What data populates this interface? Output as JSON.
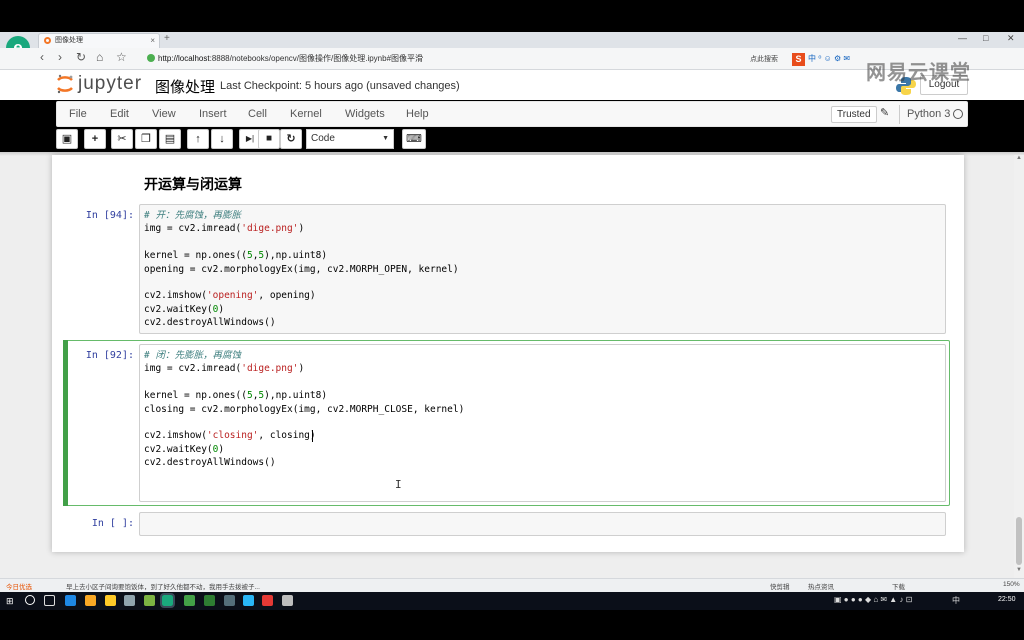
{
  "browser": {
    "tab_title": "图像处理",
    "tab_close": "×",
    "new_tab": "+",
    "url_host": "http://localhost",
    "url_rest": ":8888/notebooks/opencv/图像操作/图像处理.ipynb#图像平滑",
    "search_label": "点此搜索",
    "logo_letter": "e",
    "ext_s": "S",
    "ext_rest": "中 ⁰ ☺ ⚙ ✉",
    "nav_back": "‹",
    "nav_forward": "›",
    "nav_reload": "↻",
    "nav_home": "⌂",
    "nav_star": "☆",
    "min": "—",
    "max": "□",
    "close": "✕"
  },
  "jupyter": {
    "logo_text": "jupyter",
    "notebook_title": "图像处理",
    "checkpoint": "Last Checkpoint: 5 hours ago (unsaved changes)",
    "logout": "Logout",
    "watermark": "网易云课堂",
    "menu": [
      "File",
      "Edit",
      "View",
      "Insert",
      "Cell",
      "Kernel",
      "Widgets",
      "Help"
    ],
    "trusted": "Trusted",
    "kernel": "Python 3",
    "cell_type": "Code",
    "toolbar_glyphs": {
      "save": "▣",
      "add": "+",
      "cut": "✂",
      "copy": "❐",
      "paste": "▤",
      "up": "↑",
      "down": "↓",
      "run": "▶|",
      "stop": "■",
      "restart": "↻",
      "keyboard": "⌨",
      "dropdown": "▼",
      "pencil": "✎"
    }
  },
  "notebook": {
    "heading": "开运算与闭运算",
    "cells": [
      {
        "prompt": "In [94]:",
        "lines": [
          "# 开：先腐蚀，再膨胀",
          "img = cv2.imread('dige.png')",
          "",
          "kernel = np.ones((5,5),np.uint8)",
          "opening = cv2.morphologyEx(img, cv2.MORPH_OPEN, kernel)",
          "",
          "cv2.imshow('opening', opening)",
          "cv2.waitKey(0)",
          "cv2.destroyAllWindows()"
        ]
      },
      {
        "prompt": "In [92]:",
        "lines": [
          "# 闭：先膨胀，再腐蚀",
          "img = cv2.imread('dige.png')",
          "",
          "kernel = np.ones((5,5),np.uint8)",
          "closing = cv2.morphologyEx(img, cv2.MORPH_CLOSE, kernel)",
          "",
          "cv2.imshow('closing', closing)",
          "cv2.waitKey(0)",
          "cv2.destroyAllWindows()"
        ]
      },
      {
        "prompt": "In [ ]:",
        "lines": []
      }
    ]
  },
  "statusbar": {
    "left": "今日优选",
    "news": "早上去小区子间询要饱饭体，到了好久他都不动，我用手去拨被子...",
    "right_items": [
      "快剪辑",
      "热点资讯",
      "下载",
      "150%"
    ]
  },
  "taskbar": {
    "win": "⊞",
    "time": "22:50",
    "tray_text": "中"
  }
}
